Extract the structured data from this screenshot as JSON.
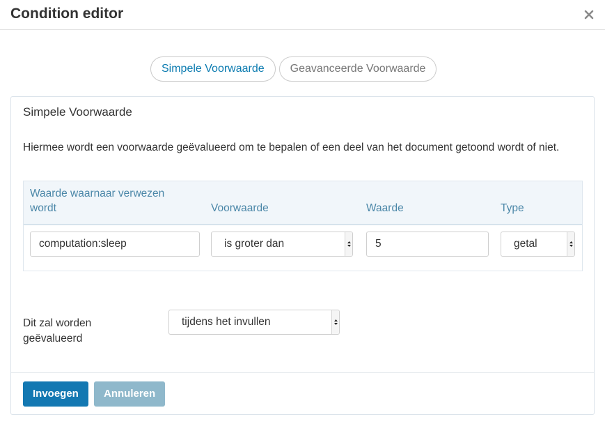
{
  "dialog": {
    "title": "Condition editor",
    "close_icon": "close-icon"
  },
  "tabs": [
    {
      "label": "Simpele Voorwaarde",
      "active": true
    },
    {
      "label": "Geavanceerde Voorwaarde",
      "active": false
    }
  ],
  "panel": {
    "title": "Simpele Voorwaarde",
    "description": "Hiermee wordt een voorwaarde geëvalueerd om te bepalen of een deel van het document getoond wordt of niet."
  },
  "condition_table": {
    "headers": {
      "reference": "Waarde waarnaar verwezen wordt",
      "condition": "Voorwaarde",
      "value": "Waarde",
      "type": "Type"
    },
    "row": {
      "reference": "computation:sleep",
      "condition": "is groter dan",
      "value": "5",
      "type": "getal"
    }
  },
  "evaluation": {
    "label": "Dit zal worden geëvalueerd",
    "selected": "tijdens het invullen"
  },
  "footer": {
    "insert_label": "Invoegen",
    "cancel_label": "Annuleren"
  },
  "colors": {
    "accent": "#1378b2",
    "accent_disabled": "#8fb8cb",
    "header_text": "#4b87a8",
    "table_head_bg": "#f1f6fa"
  }
}
